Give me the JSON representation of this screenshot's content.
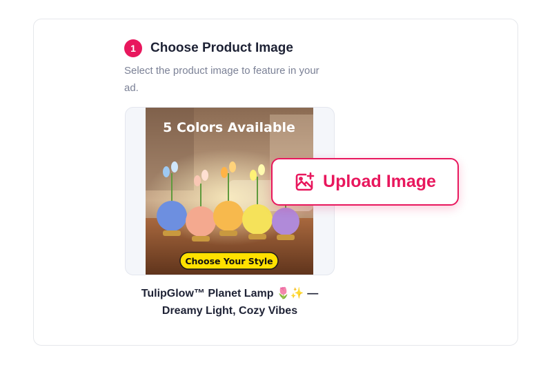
{
  "step": {
    "number": "1",
    "title": "Choose Product Image",
    "description": "Select the product image to feature in your ad."
  },
  "product_image": {
    "headline": "5 Colors Available",
    "cta": "Choose Your Style"
  },
  "upload": {
    "label": "Upload Image",
    "icon": "image-plus-icon"
  },
  "product": {
    "name": "TulipGlow™ Planet Lamp 🌷✨ — Dreamy Light, Cozy Vibes"
  },
  "colors": {
    "accent": "#e8175d",
    "heading": "#1e2235",
    "muted": "#7b8196",
    "border": "#e5e7eb"
  }
}
